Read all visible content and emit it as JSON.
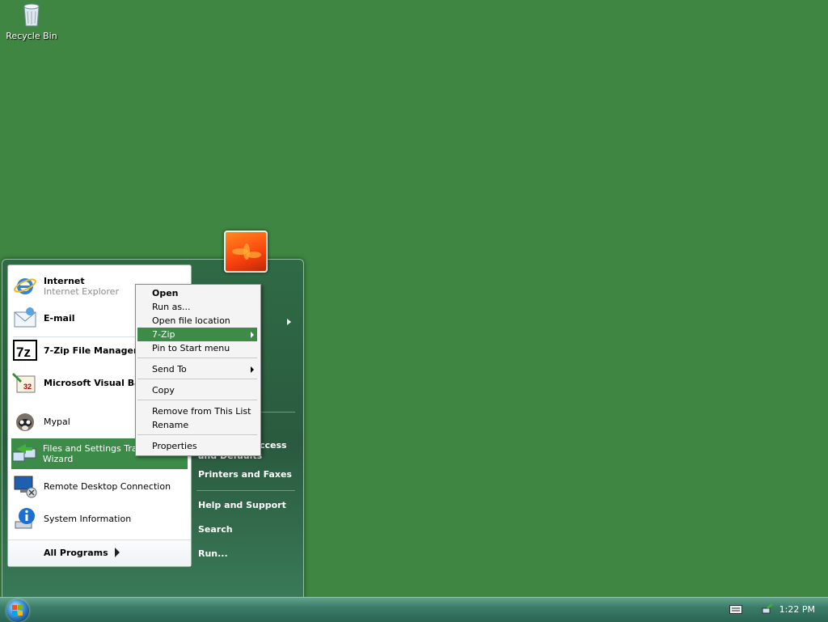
{
  "desktop": {
    "icons": [
      {
        "label": "Recycle Bin",
        "icon": "recycle-bin-icon"
      }
    ]
  },
  "start_menu": {
    "user_picture": "flower-user-picture",
    "programs": [
      {
        "title": "Internet",
        "subtitle": "Internet Explorer",
        "icon": "internet-explorer-icon"
      },
      {
        "title": "E-mail",
        "icon": "email-icon"
      },
      {
        "label": "7-Zip File Manager",
        "icon": "7zip-icon"
      },
      {
        "label": "Microsoft Visual Basic",
        "icon": "visual-basic-icon"
      },
      {
        "label": "Mypal",
        "icon": "mypal-icon"
      },
      {
        "label": "Files and Settings Transfer Wizard",
        "icon": "transfer-wizard-icon",
        "selected": true
      },
      {
        "label": "Remote Desktop Connection",
        "icon": "remote-desktop-icon"
      },
      {
        "label": "System Information",
        "icon": "system-info-icon"
      }
    ],
    "all_programs": "All Programs",
    "right_pane": {
      "set_program_access_partial": "and Defaults",
      "set_program_access_tail": "ccess",
      "printers": "Printers and Faxes",
      "help": "Help and Support",
      "search": "Search",
      "run": "Run..."
    }
  },
  "context_menu": {
    "items": [
      {
        "label": "Open",
        "bold": true
      },
      {
        "label": "Run as..."
      },
      {
        "label": "Open file location"
      },
      {
        "label": "7-Zip",
        "submenu": true,
        "highlighted": true
      },
      {
        "label": "Pin to Start menu"
      },
      {
        "label": "Send To",
        "submenu": true
      },
      {
        "label": "Copy"
      },
      {
        "label": "Remove from This List"
      },
      {
        "label": "Rename"
      },
      {
        "label": "Properties"
      }
    ]
  },
  "taskbar": {
    "clock": "1:22 PM",
    "tray_icons": [
      "keyboard-icon",
      "network-icon"
    ]
  },
  "colors": {
    "desktop": "#3f8642",
    "highlight": "#3c8b49",
    "start_menu": "#2f6a45"
  }
}
